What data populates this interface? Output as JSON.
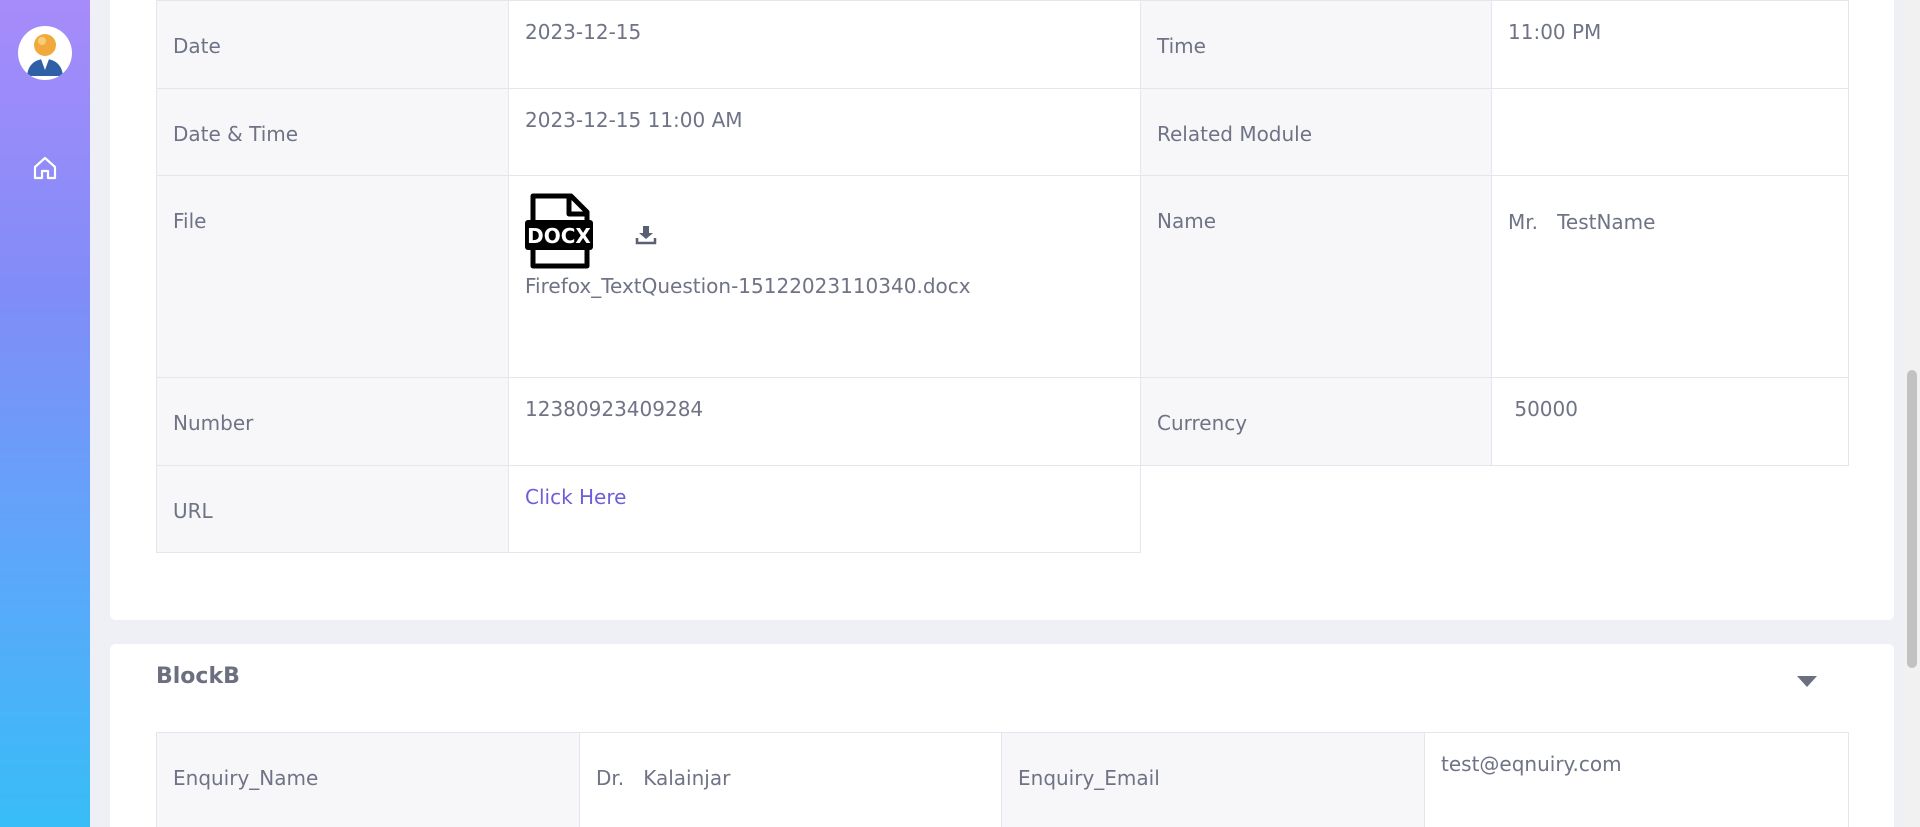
{
  "sidebar": {
    "avatar_icon": "user-avatar-icon",
    "items": [
      {
        "icon": "home-icon"
      }
    ]
  },
  "block_a": {
    "rows": [
      {
        "label1": "Date",
        "value1": "2023-12-15",
        "label2": "Time",
        "value2": "11:00 PM"
      },
      {
        "label1": "Date & Time",
        "value1": "2023-12-15 11:00 AM",
        "label2": "Related Module",
        "value2": ""
      },
      {
        "label1": "File",
        "file_badge": "DOCX",
        "file_name": "Firefox_TextQuestion-15122023110340.docx",
        "label2": "Name",
        "value2": "Mr.   TestName"
      },
      {
        "label1": "Number",
        "value1": "12380923409284",
        "label2": "Currency",
        "value2": " 50000"
      },
      {
        "label1": "URL",
        "link": "Click Here"
      }
    ]
  },
  "block_b": {
    "title": "BlockB",
    "toggle_icon": "caret-down-icon",
    "rows": [
      {
        "label1": "Enquiry_Name",
        "value1": "Dr.   Kalainjar",
        "label2": "Enquiry_Email",
        "value2": "test@eqnuiry.com"
      }
    ]
  },
  "colors": {
    "link": "#6d5fd8",
    "label_bg": "#f7f7fa",
    "page_bg": "#eef0f6"
  }
}
